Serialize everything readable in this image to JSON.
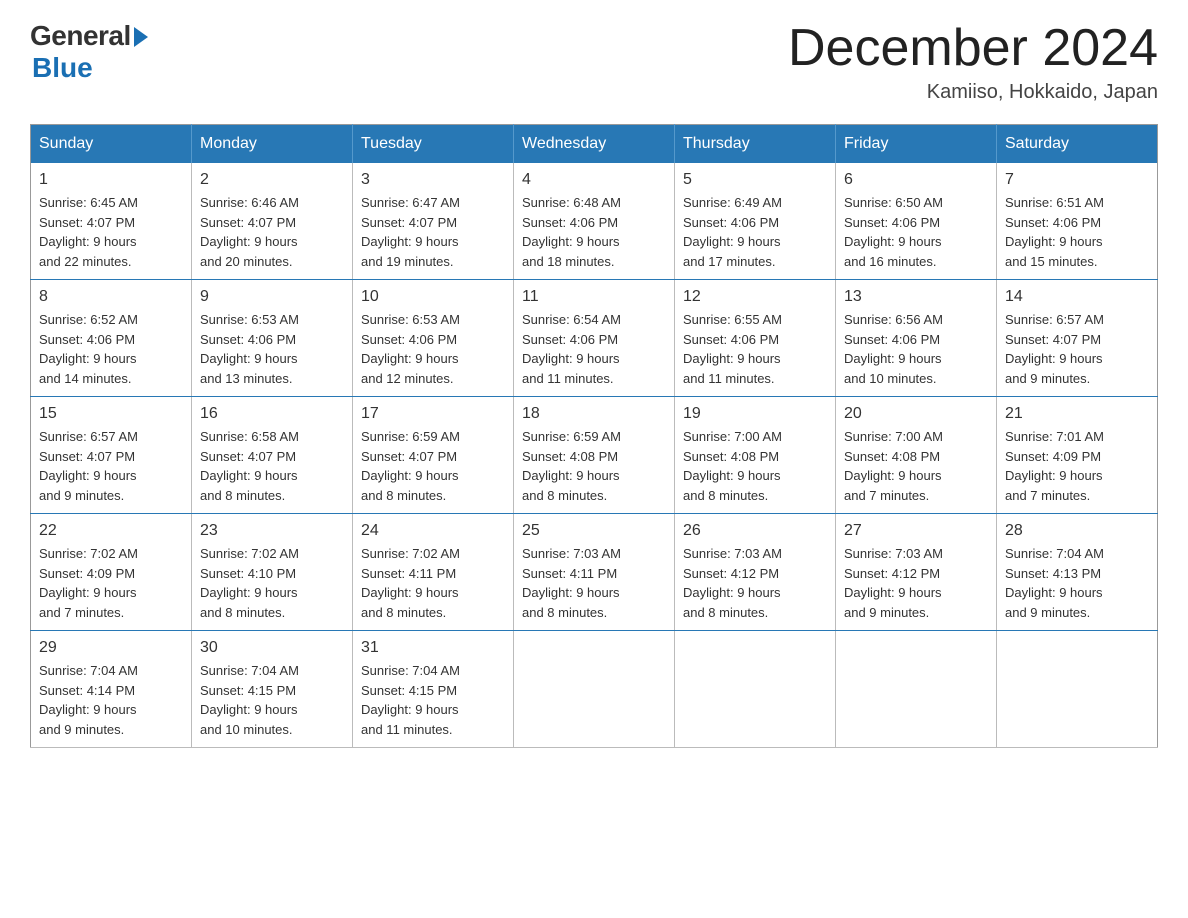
{
  "logo": {
    "general": "General",
    "blue": "Blue"
  },
  "title": "December 2024",
  "location": "Kamiiso, Hokkaido, Japan",
  "weekdays": [
    "Sunday",
    "Monday",
    "Tuesday",
    "Wednesday",
    "Thursday",
    "Friday",
    "Saturday"
  ],
  "weeks": [
    [
      {
        "day": "1",
        "sunrise": "6:45 AM",
        "sunset": "4:07 PM",
        "daylight": "9 hours and 22 minutes."
      },
      {
        "day": "2",
        "sunrise": "6:46 AM",
        "sunset": "4:07 PM",
        "daylight": "9 hours and 20 minutes."
      },
      {
        "day": "3",
        "sunrise": "6:47 AM",
        "sunset": "4:07 PM",
        "daylight": "9 hours and 19 minutes."
      },
      {
        "day": "4",
        "sunrise": "6:48 AM",
        "sunset": "4:06 PM",
        "daylight": "9 hours and 18 minutes."
      },
      {
        "day": "5",
        "sunrise": "6:49 AM",
        "sunset": "4:06 PM",
        "daylight": "9 hours and 17 minutes."
      },
      {
        "day": "6",
        "sunrise": "6:50 AM",
        "sunset": "4:06 PM",
        "daylight": "9 hours and 16 minutes."
      },
      {
        "day": "7",
        "sunrise": "6:51 AM",
        "sunset": "4:06 PM",
        "daylight": "9 hours and 15 minutes."
      }
    ],
    [
      {
        "day": "8",
        "sunrise": "6:52 AM",
        "sunset": "4:06 PM",
        "daylight": "9 hours and 14 minutes."
      },
      {
        "day": "9",
        "sunrise": "6:53 AM",
        "sunset": "4:06 PM",
        "daylight": "9 hours and 13 minutes."
      },
      {
        "day": "10",
        "sunrise": "6:53 AM",
        "sunset": "4:06 PM",
        "daylight": "9 hours and 12 minutes."
      },
      {
        "day": "11",
        "sunrise": "6:54 AM",
        "sunset": "4:06 PM",
        "daylight": "9 hours and 11 minutes."
      },
      {
        "day": "12",
        "sunrise": "6:55 AM",
        "sunset": "4:06 PM",
        "daylight": "9 hours and 11 minutes."
      },
      {
        "day": "13",
        "sunrise": "6:56 AM",
        "sunset": "4:06 PM",
        "daylight": "9 hours and 10 minutes."
      },
      {
        "day": "14",
        "sunrise": "6:57 AM",
        "sunset": "4:07 PM",
        "daylight": "9 hours and 9 minutes."
      }
    ],
    [
      {
        "day": "15",
        "sunrise": "6:57 AM",
        "sunset": "4:07 PM",
        "daylight": "9 hours and 9 minutes."
      },
      {
        "day": "16",
        "sunrise": "6:58 AM",
        "sunset": "4:07 PM",
        "daylight": "9 hours and 8 minutes."
      },
      {
        "day": "17",
        "sunrise": "6:59 AM",
        "sunset": "4:07 PM",
        "daylight": "9 hours and 8 minutes."
      },
      {
        "day": "18",
        "sunrise": "6:59 AM",
        "sunset": "4:08 PM",
        "daylight": "9 hours and 8 minutes."
      },
      {
        "day": "19",
        "sunrise": "7:00 AM",
        "sunset": "4:08 PM",
        "daylight": "9 hours and 8 minutes."
      },
      {
        "day": "20",
        "sunrise": "7:00 AM",
        "sunset": "4:08 PM",
        "daylight": "9 hours and 7 minutes."
      },
      {
        "day": "21",
        "sunrise": "7:01 AM",
        "sunset": "4:09 PM",
        "daylight": "9 hours and 7 minutes."
      }
    ],
    [
      {
        "day": "22",
        "sunrise": "7:02 AM",
        "sunset": "4:09 PM",
        "daylight": "9 hours and 7 minutes."
      },
      {
        "day": "23",
        "sunrise": "7:02 AM",
        "sunset": "4:10 PM",
        "daylight": "9 hours and 8 minutes."
      },
      {
        "day": "24",
        "sunrise": "7:02 AM",
        "sunset": "4:11 PM",
        "daylight": "9 hours and 8 minutes."
      },
      {
        "day": "25",
        "sunrise": "7:03 AM",
        "sunset": "4:11 PM",
        "daylight": "9 hours and 8 minutes."
      },
      {
        "day": "26",
        "sunrise": "7:03 AM",
        "sunset": "4:12 PM",
        "daylight": "9 hours and 8 minutes."
      },
      {
        "day": "27",
        "sunrise": "7:03 AM",
        "sunset": "4:12 PM",
        "daylight": "9 hours and 9 minutes."
      },
      {
        "day": "28",
        "sunrise": "7:04 AM",
        "sunset": "4:13 PM",
        "daylight": "9 hours and 9 minutes."
      }
    ],
    [
      {
        "day": "29",
        "sunrise": "7:04 AM",
        "sunset": "4:14 PM",
        "daylight": "9 hours and 9 minutes."
      },
      {
        "day": "30",
        "sunrise": "7:04 AM",
        "sunset": "4:15 PM",
        "daylight": "9 hours and 10 minutes."
      },
      {
        "day": "31",
        "sunrise": "7:04 AM",
        "sunset": "4:15 PM",
        "daylight": "9 hours and 11 minutes."
      },
      null,
      null,
      null,
      null
    ]
  ],
  "labels": {
    "sunrise": "Sunrise:",
    "sunset": "Sunset:",
    "daylight": "Daylight:"
  }
}
